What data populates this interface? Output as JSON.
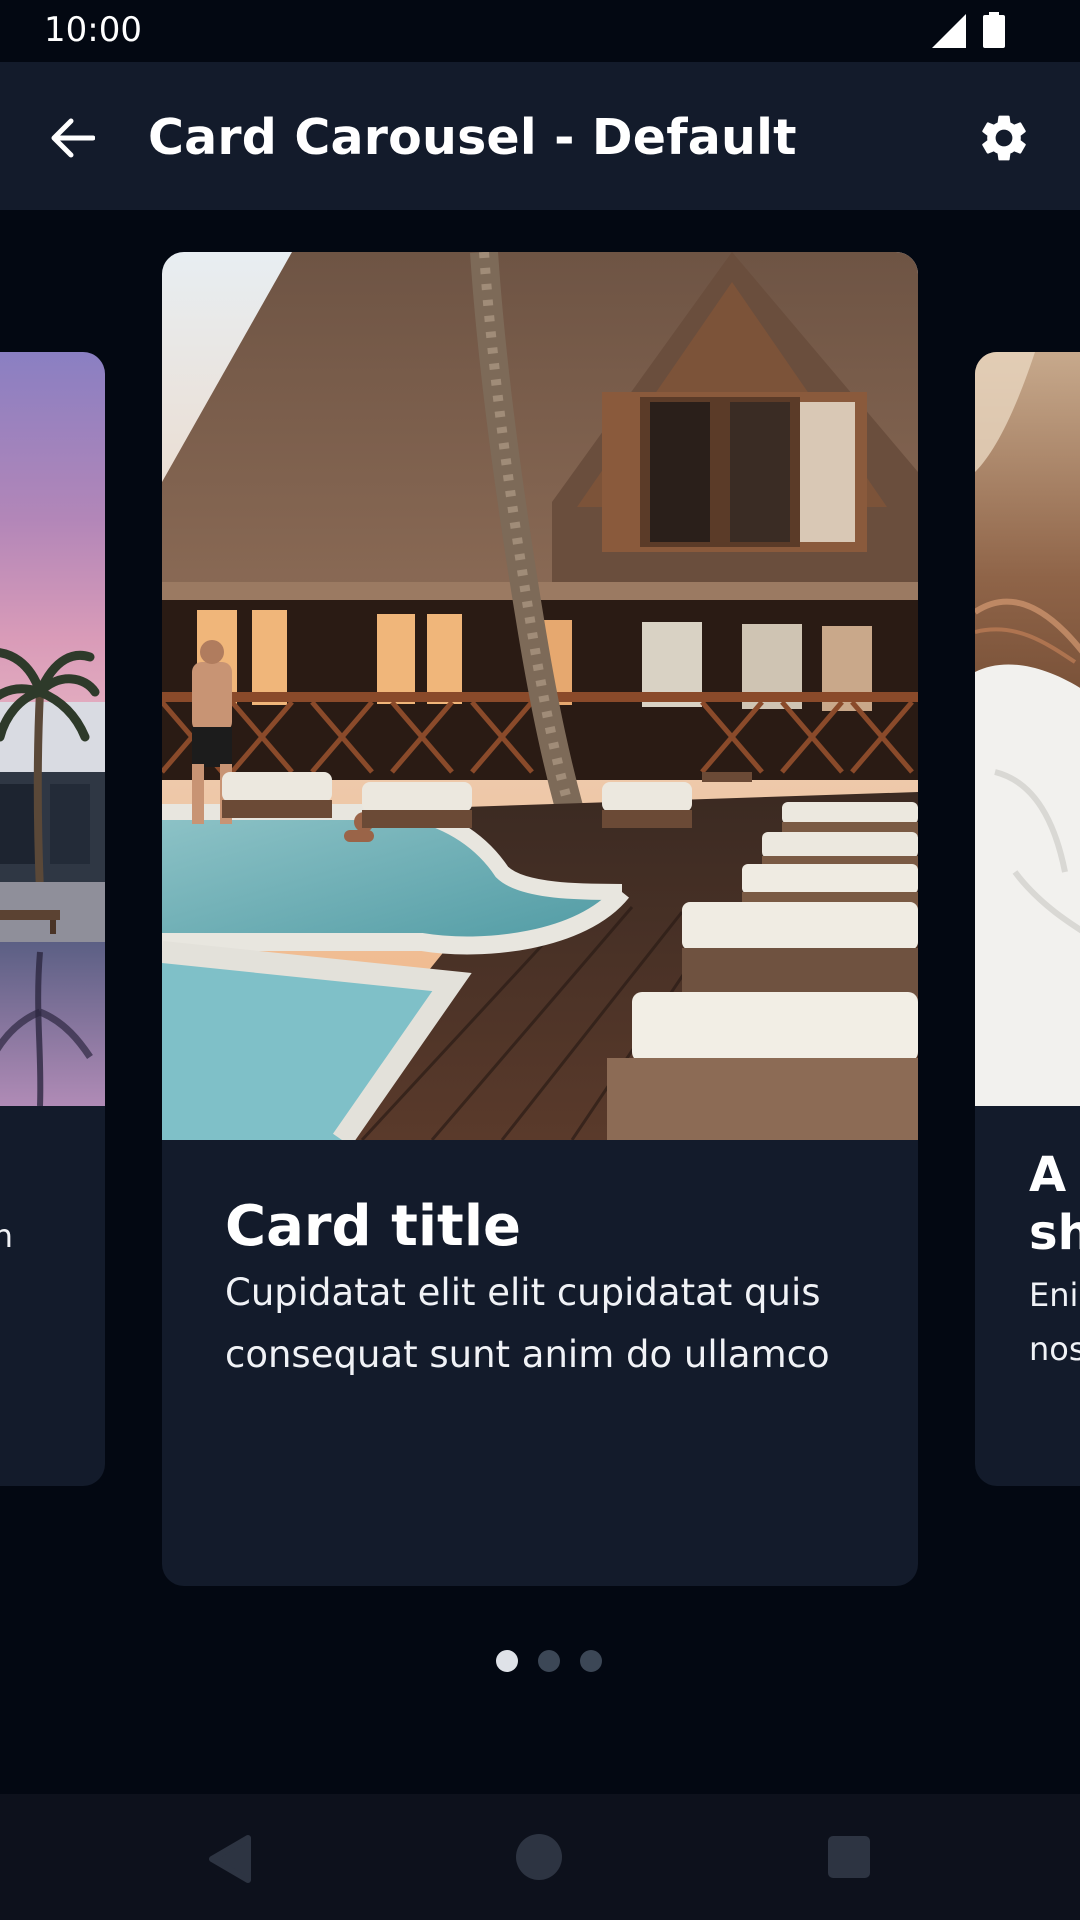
{
  "status_bar": {
    "time": "10:00",
    "signal_icon": "signal-icon",
    "battery_icon": "battery-icon"
  },
  "app_bar": {
    "title": "Card Carousel - Default",
    "back_icon": "arrow-left-icon",
    "settings_icon": "gear-icon"
  },
  "carousel": {
    "cards": [
      {
        "title": "",
        "text": "n",
        "image": "resort-sunset-palm-photo"
      },
      {
        "title": "Card title",
        "text": "Cupidatat elit elit cupidatat quis consequat sunt anim do ullamco",
        "image": "resort-pool-lodge-photo"
      },
      {
        "title": "A l sh",
        "title_line1": "A l",
        "title_line2": "sh",
        "text_line1": "Eni",
        "text_line2": "nos",
        "image": "person-white-towel-photo"
      }
    ],
    "pagination": {
      "count": 3,
      "active_index": 0
    }
  },
  "nav_bar": {
    "back_icon": "triangle-back-icon",
    "home_icon": "circle-home-icon",
    "recents_icon": "square-recents-icon"
  },
  "colors": {
    "background": "#030812",
    "surface": "#131b2b",
    "nav_bar": "#0d111c",
    "dot_active": "#dfe2e8",
    "dot_inactive": "#3c4756"
  }
}
